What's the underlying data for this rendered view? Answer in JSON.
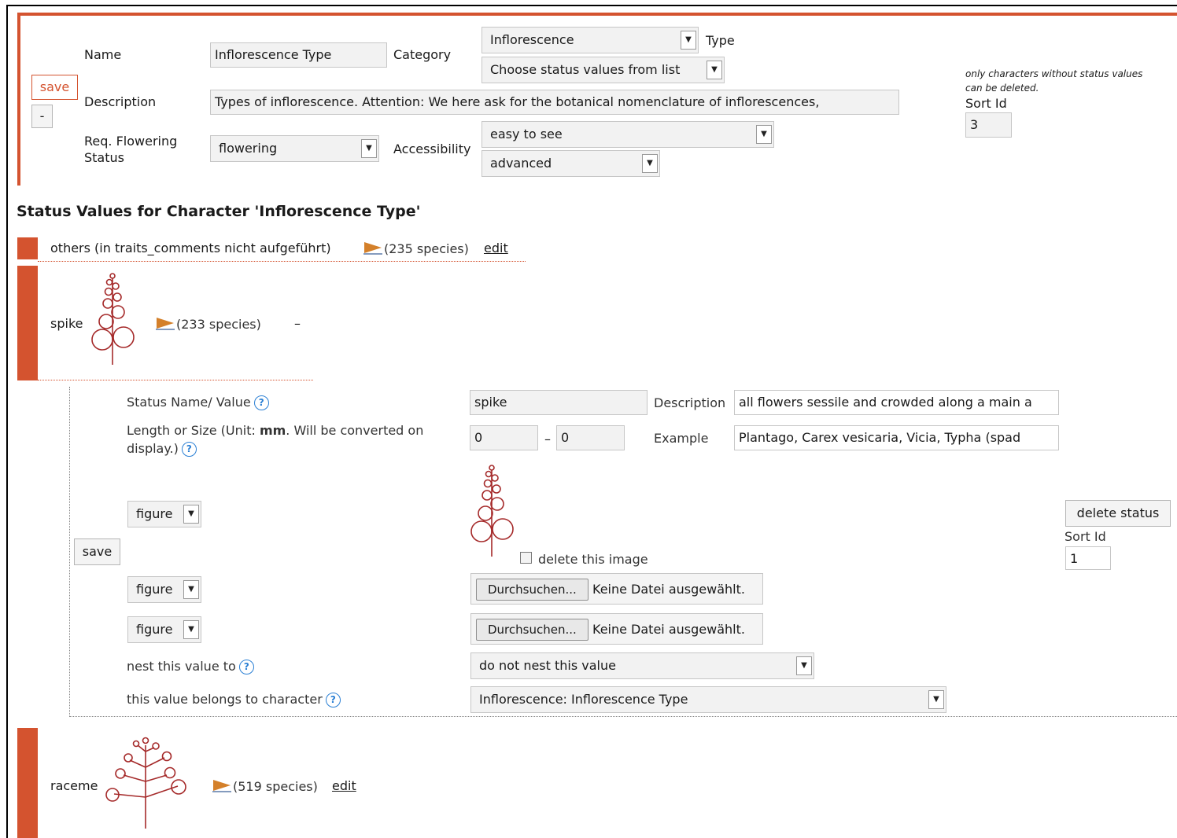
{
  "character_form": {
    "name_label": "Name",
    "name_value": "Inflorescence Type",
    "category_label": "Category",
    "category_value": "Inflorescence",
    "type_label": "Type",
    "type_value": "Choose status values from list",
    "description_label": "Description",
    "description_value": "Types  of inflorescence. Attention: We here ask for the botanical nomenclature of inflorescences,",
    "req_flowering_label_1": "Req. Flowering",
    "req_flowering_label_2": "Status",
    "req_flowering_value": "flowering",
    "accessibility_label": "Accessibility",
    "accessibility_value_1": "easy to see",
    "accessibility_value_2": "advanced",
    "save_label": "save",
    "collapse_label": "-",
    "delete_note_1": "only characters without status values",
    "delete_note_2": "can be deleted.",
    "sort_id_label": "Sort Id",
    "sort_id_value": "3"
  },
  "section_title": "Status Values for Character 'Inflorescence Type'",
  "status_values": [
    {
      "name": "others (in traits_comments nicht aufgeführt)",
      "species": "(235 species)",
      "action": "edit"
    },
    {
      "name": "spike",
      "species": "(233 species)",
      "action": "–"
    },
    {
      "name": "raceme",
      "species": "(519 species)",
      "action": "edit"
    }
  ],
  "status_form": {
    "status_name_label": "Status Name/ Value",
    "status_name_value": "spike",
    "description_label": "Description",
    "description_value": "all flowers sessile and crowded along a main a",
    "length_label_1a": "Length or Size (Unit: ",
    "length_label_unit": "mm",
    "length_label_1b": ". Will be converted on",
    "length_label_2": "display.)",
    "length_min": "0",
    "length_dash": "–",
    "length_max": "0",
    "example_label": "Example",
    "example_value": "Plantago, Carex vesicaria, Vicia, Typha (spad",
    "figure_select_1": "figure",
    "figure_select_2": "figure",
    "figure_select_3": "figure",
    "save_label": "save",
    "delete_image_label": "delete this image",
    "browse_label": "Durchsuchen...",
    "no_file_label": "Keine Datei ausgewählt.",
    "delete_status_label": "delete status",
    "sort_id_label": "Sort Id",
    "sort_id_value": "1",
    "nest_label": "nest this value to",
    "nest_value": "do not nest this value",
    "belongs_label": "this value belongs to character",
    "belongs_value": "Inflorescence: Inflorescence Type"
  },
  "icons": {
    "help": "?",
    "dropdown": "▼"
  },
  "colors": {
    "accent": "#d4532f",
    "figure": "#a52a2a",
    "help": "#2a7fd4"
  }
}
